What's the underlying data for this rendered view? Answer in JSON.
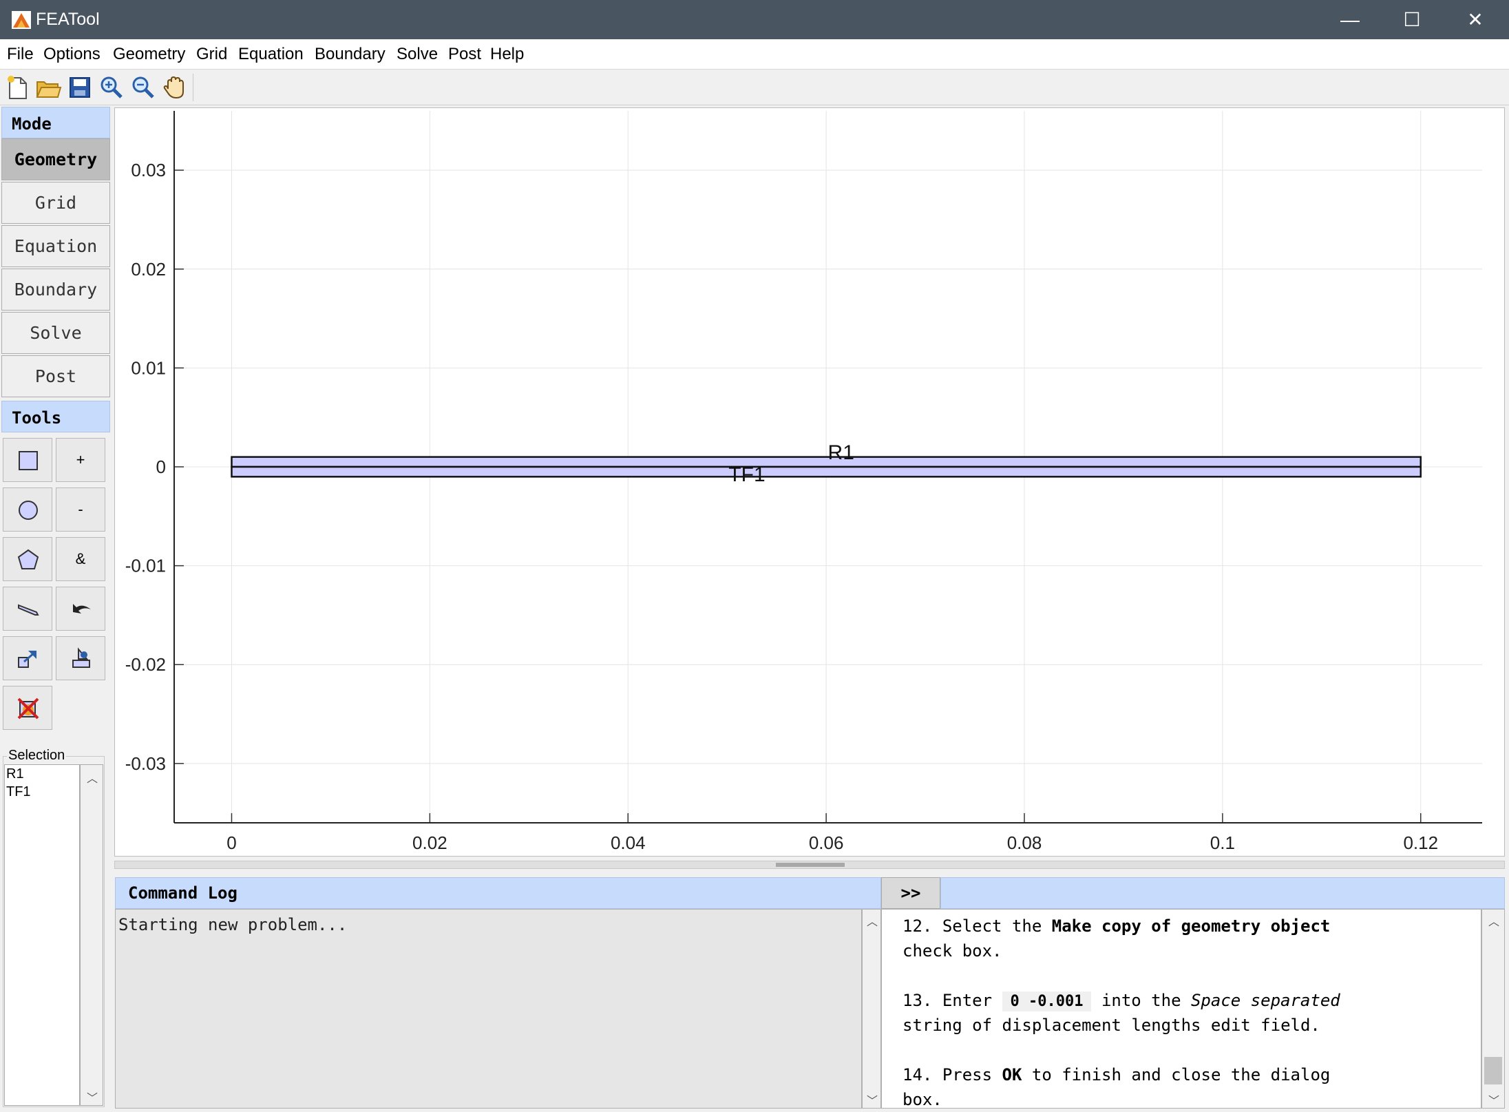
{
  "window": {
    "title": "FEATool",
    "minimize_glyph": "—",
    "maximize_glyph": "☐",
    "close_glyph": "✕"
  },
  "menu": [
    "File",
    "Options",
    "Geometry",
    "Grid",
    "Equation",
    "Boundary",
    "Solve",
    "Post",
    "Help"
  ],
  "toolbar_icons": [
    "new-file-icon",
    "open-folder-icon",
    "save-icon",
    "zoom-in-icon",
    "zoom-out-icon",
    "pan-hand-icon"
  ],
  "sidebar": {
    "mode_header": "Mode",
    "modes": [
      "Geometry",
      "Grid",
      "Equation",
      "Boundary",
      "Solve",
      "Post"
    ],
    "active_mode": "Geometry",
    "tools_header": "Tools",
    "tool_labels": {
      "union": "+",
      "subtract": "-",
      "intersect": "&"
    },
    "tool_icons": [
      "rectangle-icon",
      "circle-icon",
      "polygon-icon",
      "line-icon",
      "undo-icon",
      "transform-icon",
      "scale-icon",
      "delete-icon"
    ],
    "selection_label": "Selection",
    "selection_items": [
      "R1",
      "TF1"
    ]
  },
  "plot": {
    "x_ticks": [
      "0",
      "0.02",
      "0.04",
      "0.06",
      "0.08",
      "0.1",
      "0.12"
    ],
    "y_ticks": [
      "0.03",
      "0.02",
      "0.01",
      "0",
      "-0.01",
      "-0.02",
      "-0.03"
    ],
    "x_range": [
      -0.0058,
      0.1262
    ],
    "y_range": [
      -0.036,
      0.036
    ],
    "objects": [
      {
        "label": "R1",
        "x": [
          0,
          0.12
        ],
        "y": [
          0,
          0.001
        ]
      },
      {
        "label": "TF1",
        "x": [
          0,
          0.12
        ],
        "y": [
          -0.001,
          0
        ]
      }
    ],
    "fill_color": "#ccccff",
    "grid": true
  },
  "command_log": {
    "header": "Command Log",
    "text": "Starting new problem..."
  },
  "expand_button": ">>",
  "help": {
    "step12_num": "12.",
    "step12_a": "Select the",
    "step12_b": "Make copy of geometry object",
    "step12_c": "check box.",
    "step13_num": "13.",
    "step13_a": "Enter",
    "step13_code": "0 -0.001",
    "step13_b": "into the",
    "step13_c": "Space separated",
    "step13_d": "string of displacement lengths edit field.",
    "step14_num": "14.",
    "step14_a": "Press",
    "step14_b": "OK",
    "step14_c": "to finish and close the dialog",
    "step14_d": "box."
  }
}
